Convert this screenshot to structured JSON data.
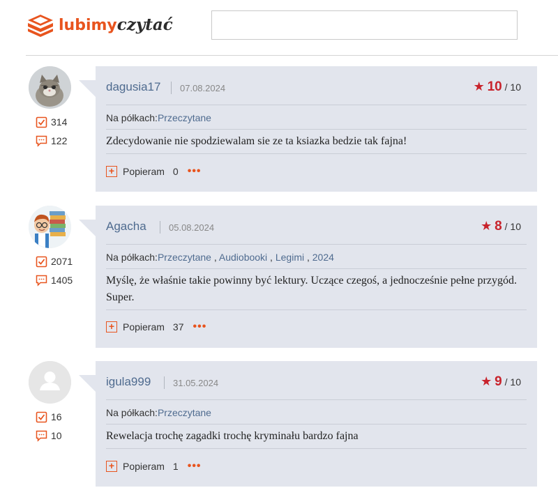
{
  "header": {
    "logo_part1": "lubimy",
    "logo_part2": "czytać",
    "search_placeholder": ""
  },
  "labels": {
    "shelves_prefix": "Na półkach:",
    "support": "Popieram",
    "rating_suffix": "/ 10",
    "more": "•••"
  },
  "colors": {
    "accent": "#e8541e",
    "card_bg": "#e2e5ed",
    "username": "#4f6b8f",
    "rating_star": "#c8232c"
  },
  "reviews": [
    {
      "username": "dagusia17",
      "date": "07.08.2024",
      "rating": "10",
      "stats": {
        "read": "314",
        "comments": "122"
      },
      "shelves": [
        "Przeczytane"
      ],
      "text": "Zdecydowanie nie spodziewalam sie ze ta ksiazka bedzie tak fajna!",
      "support_count": "0",
      "avatar": "kitten-avatar"
    },
    {
      "username": "Agacha",
      "date": "05.08.2024",
      "rating": "8",
      "stats": {
        "read": "2071",
        "comments": "1405"
      },
      "shelves": [
        "Przeczytane",
        "Audiobooki",
        "Legimi",
        "2024"
      ],
      "text": "Myślę, że właśnie takie powinny być lektury. Uczące czegoś, a jednocześnie pełne przygód. Super.",
      "support_count": "37",
      "avatar": "cartoon-reader-avatar"
    },
    {
      "username": "igula999",
      "date": "31.05.2024",
      "rating": "9",
      "stats": {
        "read": "16",
        "comments": "10"
      },
      "shelves": [
        "Przeczytane"
      ],
      "text": "Rewelacja trochę zagadki trochę kryminału bardzo fajna",
      "support_count": "1",
      "avatar": "default-user-avatar"
    }
  ]
}
